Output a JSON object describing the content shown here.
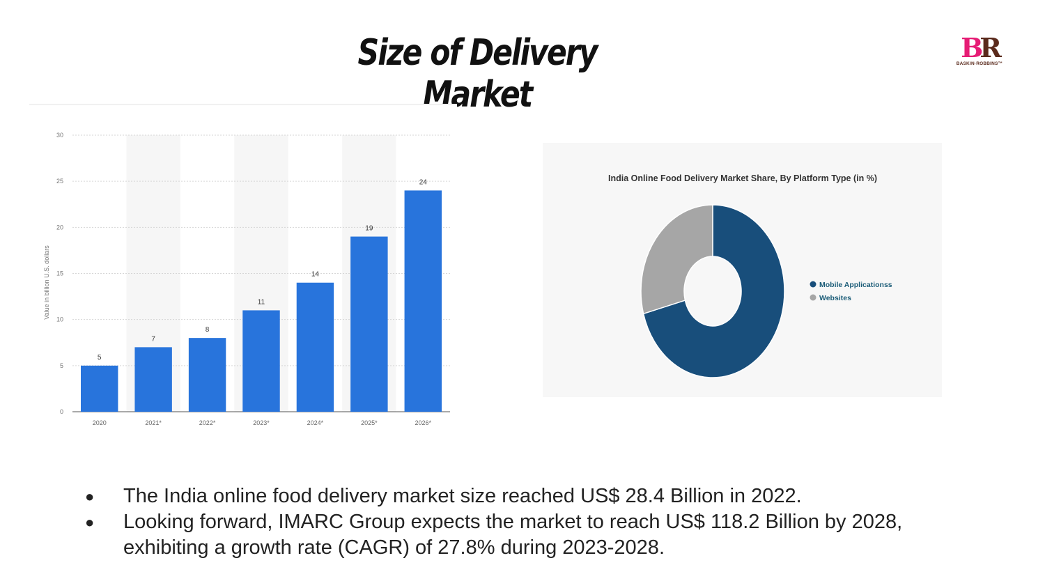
{
  "slide": {
    "title": "Size of Delivery Market"
  },
  "logo": {
    "mark_b": "B",
    "mark_r": "R",
    "text": "BASKIN·ROBBINS™"
  },
  "colors": {
    "bar": "#2874dc",
    "mobile": "#184e7b",
    "websites": "#a6a6a6",
    "legend_text": "#1c5d78"
  },
  "chart_data": [
    {
      "type": "bar",
      "categories": [
        "2020",
        "2021*",
        "2022*",
        "2023*",
        "2024*",
        "2025*",
        "2026*"
      ],
      "values": [
        5,
        7,
        8,
        11,
        14,
        19,
        24
      ],
      "data_labels": [
        "5",
        "7",
        "8",
        "11",
        "14",
        "19",
        "24"
      ],
      "ylabel": "Value in billion U.S. dollars",
      "ylim": [
        0,
        30
      ],
      "yticks": [
        "0",
        "5",
        "10",
        "15",
        "20",
        "25",
        "30"
      ],
      "grid": true
    },
    {
      "type": "pie",
      "variant": "donut",
      "title": "India Online Food Delivery Market Share, By Platform Type (in %)",
      "series": [
        {
          "name": "Mobile Applicationss",
          "value": 70.8
        },
        {
          "name": "Websites",
          "value": 29.2
        }
      ],
      "legend_position": "right"
    }
  ],
  "bullets": [
    "The India online food delivery market size reached US$ 28.4 Billion in 2022.",
    "Looking forward, IMARC Group expects the market to reach US$ 118.2 Billion by 2028, exhibiting a growth rate (CAGR) of 27.8% during 2023-2028."
  ]
}
